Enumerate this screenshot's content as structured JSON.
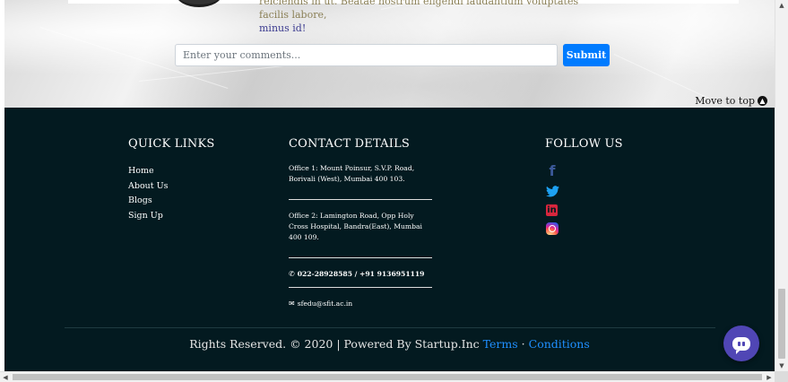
{
  "comment_section": {
    "partial_comment_line1": "reiciendis in ut. Beatae nostrum eligendi laudantium voluptates facilis labore,",
    "partial_comment_line2": "minus id!",
    "input_placeholder": "Enter your comments...",
    "submit_label": "Submit"
  },
  "move_to_top": {
    "label": "Move to top",
    "icon": "arrow-up-circle-icon"
  },
  "footer": {
    "quick_links": {
      "title": "QUICK LINKS",
      "items": [
        "Home",
        "About Us",
        "Blogs",
        "Sign Up"
      ]
    },
    "contact": {
      "title": "CONTACT DETAILS",
      "office1": "Office 1: Mount Poinsur, S.V.P. Road, Borivali (West), Mumbai 400 103.",
      "office2": "Office 2: Lamington Road, Opp Holy Cross Hospital, Bandra(East), Mumbai 400 109.",
      "phone": "022-28928585 / +91 9136951119",
      "email": "sfedu@sfit.ac.in"
    },
    "follow": {
      "title": "FOLLOW US",
      "icons": [
        "facebook-icon",
        "twitter-icon",
        "linkedin-icon",
        "instagram-icon"
      ]
    },
    "copyright": {
      "text": "Rights Reserved. © 2020 | Powered By Startup.Inc",
      "terms": "Terms",
      "separator": "·",
      "conditions": "Conditions"
    }
  },
  "colors": {
    "footer_bg": "#031a20",
    "link": "#1f8fff",
    "submit": "#007bff",
    "chat": "#5046b5"
  }
}
